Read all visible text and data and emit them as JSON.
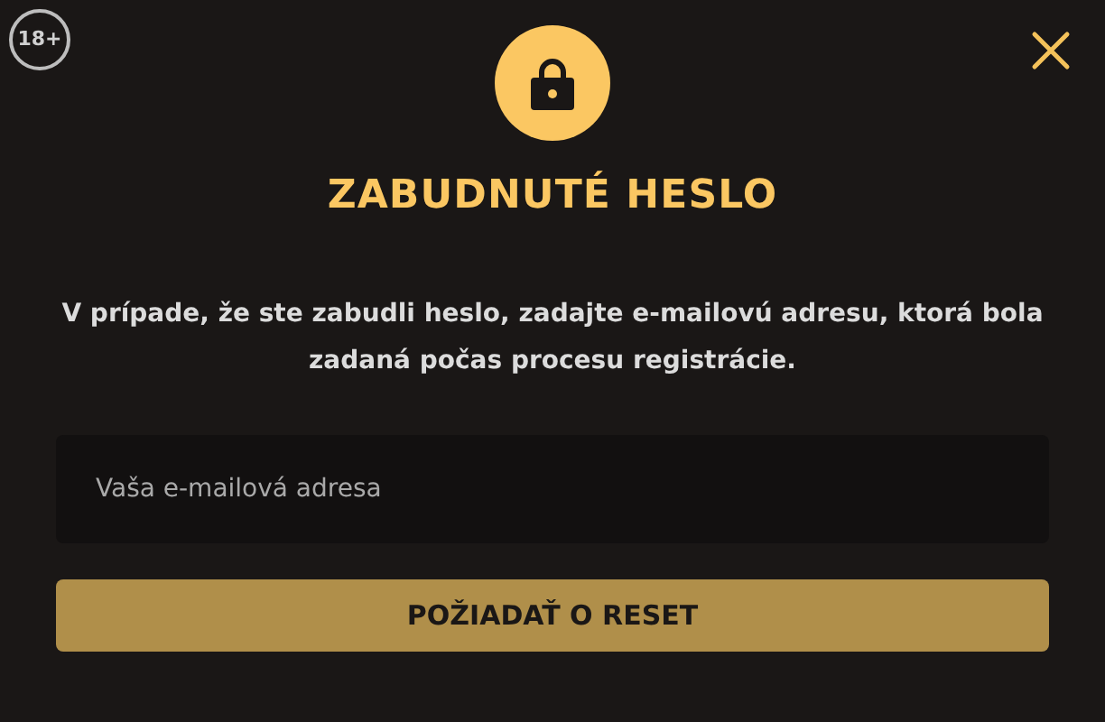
{
  "age_badge": "18+",
  "title": "ZABUDNUTÉ HESLO",
  "description": "V prípade, že ste zabudli heslo, zadajte e-mailovú adresu, ktorá bola zadaná počas procesu registrácie.",
  "email_field": {
    "placeholder": "Vaša e-mailová adresa"
  },
  "submit_button": "POŽIADAŤ O RESET"
}
